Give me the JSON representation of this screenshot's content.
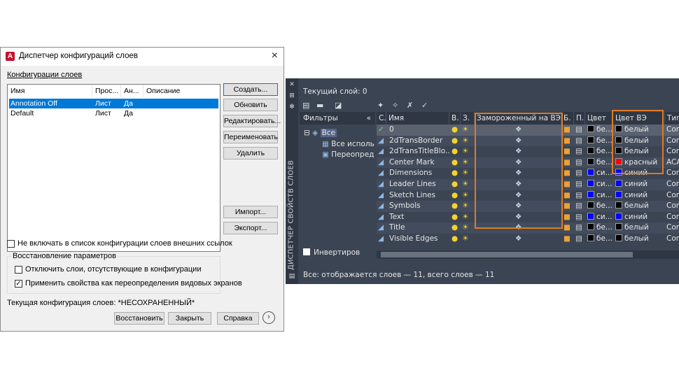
{
  "dialog": {
    "title": "Диспетчер конфигураций слоев",
    "close_icon": "×",
    "section_label": "Конфигурации слоев",
    "list_headers": [
      "Имя",
      "Прос...",
      "Ан...",
      "Описание"
    ],
    "rows": [
      {
        "name": "Annotation Off",
        "space": "Лист",
        "ann": "Да",
        "desc": ""
      },
      {
        "name": "Default",
        "space": "Лист",
        "ann": "Да",
        "desc": ""
      }
    ],
    "buttons": {
      "create": "Создать...",
      "update": "Обновить",
      "edit": "Редактировать...",
      "rename": "Переименовать",
      "delete": "Удалить",
      "import": "Импорт...",
      "export": "Экспорт..."
    },
    "exclude_xref_label": "Не включать в список конфигурации слоев внешних ссылок",
    "restore_group_label": "Восстановление параметров",
    "turn_off_missing_label": "Отключить слои, отсутствующие в конфигурации",
    "apply_overrides_label": "Применить свойства как переопределения видовых экранов",
    "current_config_label": "Текущая конфигурация слоев: *НЕСОХРАНЕННЫЙ*",
    "bottom_buttons": {
      "restore": "Восстановить",
      "close": "Закрыть",
      "help": "Справка"
    },
    "more_icon": "›",
    "colors": {
      "selection": "#0078d7"
    }
  },
  "palette": {
    "side_title": "ДИСПЕТЧЕР СВОЙСТВ СЛОЕВ",
    "current_layer": "Текущий слой: 0",
    "filters_header": "Фильтры",
    "collapse_icon": "«",
    "tree": [
      "Все",
      "Все исполь",
      "Переопред"
    ],
    "invert_label": "Инвертиров",
    "columns": [
      "С.",
      "Имя",
      "В.",
      "З.",
      "Замороженный на ВЭ",
      "Б.",
      "П.",
      "Цвет",
      "Цвет ВЭ",
      "Тип"
    ],
    "layers": [
      {
        "name": "0",
        "color": "бе...",
        "vp_color": "белый",
        "type": "Cont",
        "swatch": "#000000",
        "vp_swatch": "#000000"
      },
      {
        "name": "2dTransBorder",
        "color": "бе...",
        "vp_color": "белый",
        "type": "Cont",
        "swatch": "#000000",
        "vp_swatch": "#000000"
      },
      {
        "name": "2dTransTitleBlo...",
        "color": "бе...",
        "vp_color": "белый",
        "type": "Cont",
        "swatch": "#000000",
        "vp_swatch": "#000000"
      },
      {
        "name": "Center Mark",
        "color": "бе...",
        "vp_color": "красный",
        "type": "ACA",
        "swatch": "#000000",
        "vp_swatch": "#ff0000"
      },
      {
        "name": "Dimensions",
        "color": "си...",
        "vp_color": "синий",
        "type": "Cont",
        "swatch": "#0000ff",
        "vp_swatch": "#0000ff"
      },
      {
        "name": "Leader Lines",
        "color": "си...",
        "vp_color": "синий",
        "type": "Cont",
        "swatch": "#0000ff",
        "vp_swatch": "#0000ff"
      },
      {
        "name": "Sketch Lines",
        "color": "си...",
        "vp_color": "синий",
        "type": "Cont",
        "swatch": "#0000ff",
        "vp_swatch": "#0000ff"
      },
      {
        "name": "Symbols",
        "color": "бе...",
        "vp_color": "белый",
        "type": "Cont",
        "swatch": "#000000",
        "vp_swatch": "#000000"
      },
      {
        "name": "Text",
        "color": "си...",
        "vp_color": "синий",
        "type": "Cont",
        "swatch": "#0000ff",
        "vp_swatch": "#0000ff"
      },
      {
        "name": "Title",
        "color": "бе...",
        "vp_color": "белый",
        "type": "Cont",
        "swatch": "#000000",
        "vp_swatch": "#000000"
      },
      {
        "name": "Visible Edges",
        "color": "бе...",
        "vp_color": "белый",
        "type": "Cont",
        "swatch": "#000000",
        "vp_swatch": "#000000"
      }
    ],
    "status": "Все: отображается слоев — 11, всего слоев — 11",
    "colors": {
      "background": "#3b4453",
      "highlight": "#e07a24"
    }
  }
}
